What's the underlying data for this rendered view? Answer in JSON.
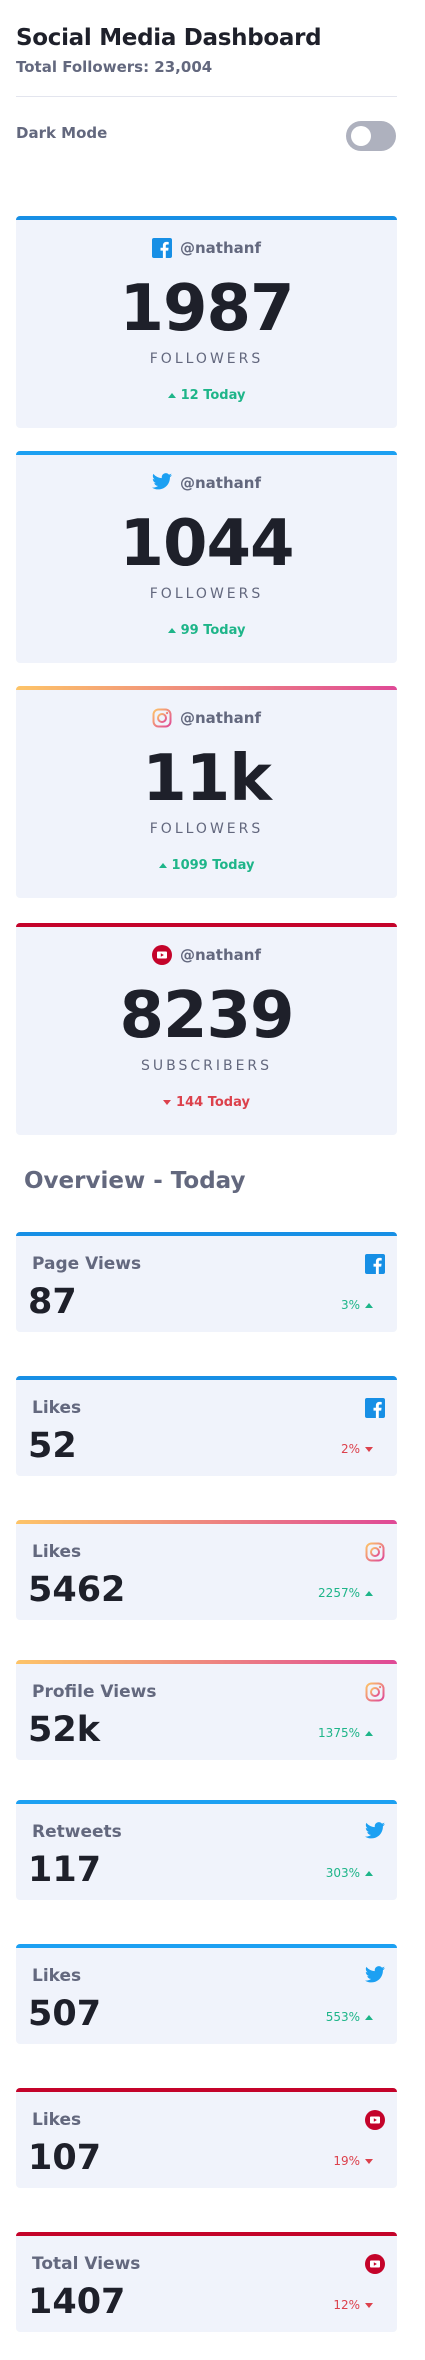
{
  "header": {
    "title": "Social Media Dashboard",
    "total_followers": "Total Followers: 23,004"
  },
  "dark_mode": {
    "label": "Dark Mode",
    "enabled": false
  },
  "follower_cards": [
    {
      "network": "facebook",
      "icon": "facebook-icon",
      "handle": "@nathanf",
      "count": "1987",
      "unit": "FOLLOWERS",
      "today": "12 Today",
      "trend": "up"
    },
    {
      "network": "twitter",
      "icon": "twitter-icon",
      "handle": "@nathanf",
      "count": "1044",
      "unit": "FOLLOWERS",
      "today": "99 Today",
      "trend": "up"
    },
    {
      "network": "instagram",
      "icon": "instagram-icon",
      "handle": "@nathanf",
      "count": "11k",
      "unit": "FOLLOWERS",
      "today": "1099 Today",
      "trend": "up"
    },
    {
      "network": "youtube",
      "icon": "youtube-icon",
      "handle": "@nathanf",
      "count": "8239",
      "unit": "SUBSCRIBERS",
      "today": "144 Today",
      "trend": "down"
    }
  ],
  "overview": {
    "title": "Overview - Today",
    "cards": [
      {
        "network": "facebook",
        "icon": "facebook-icon",
        "label": "Page Views",
        "value": "87",
        "change": "3%",
        "trend": "up"
      },
      {
        "network": "facebook",
        "icon": "facebook-icon",
        "label": "Likes",
        "value": "52",
        "change": "2%",
        "trend": "down"
      },
      {
        "network": "instagram",
        "icon": "instagram-icon",
        "label": "Likes",
        "value": "5462",
        "change": "2257%",
        "trend": "up"
      },
      {
        "network": "instagram",
        "icon": "instagram-icon",
        "label": "Profile Views",
        "value": "52k",
        "change": "1375%",
        "trend": "up"
      },
      {
        "network": "twitter",
        "icon": "twitter-icon",
        "label": "Retweets",
        "value": "117",
        "change": "303%",
        "trend": "up"
      },
      {
        "network": "twitter",
        "icon": "twitter-icon",
        "label": "Likes",
        "value": "507",
        "change": "553%",
        "trend": "up"
      },
      {
        "network": "youtube",
        "icon": "youtube-icon",
        "label": "Likes",
        "value": "107",
        "change": "19%",
        "trend": "down"
      },
      {
        "network": "youtube",
        "icon": "youtube-icon",
        "label": "Total Views",
        "value": "1407",
        "change": "12%",
        "trend": "down"
      }
    ]
  },
  "colors": {
    "facebook": "#178fe5",
    "twitter": "#1ca0f2",
    "instagram_gradient": [
      "#fdc468",
      "#df4996"
    ],
    "youtube": "#c4032a",
    "up": "#1eb589",
    "down": "#dc414c"
  }
}
